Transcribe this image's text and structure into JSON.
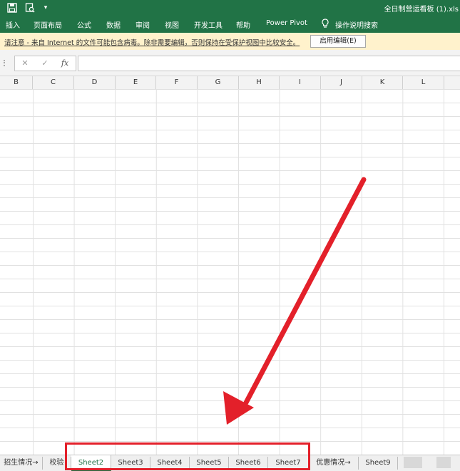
{
  "titlebar": {
    "title": "全日制营运看板 (1).xls",
    "qa_save_icon": "save-icon",
    "qa_preview_icon": "print-preview-icon",
    "qa_more_icon": "customize-arrow-icon"
  },
  "ribbon": {
    "tabs": [
      "插入",
      "页面布局",
      "公式",
      "数据",
      "审阅",
      "视图",
      "开发工具",
      "帮助",
      "Power Pivot"
    ],
    "tell_me": "操作说明搜索"
  },
  "message_bar": {
    "text": "请注意 - 来自 Internet 的文件可能包含病毒。除非需要编辑，否则保持在受保护视图中比较安全。",
    "enable_button": "启用编辑(E)"
  },
  "formula_bar": {
    "cancel": "✕",
    "enter": "✓",
    "fx": "fx",
    "value": ""
  },
  "columns": [
    "B",
    "C",
    "D",
    "E",
    "F",
    "G",
    "H",
    "I",
    "J",
    "K",
    "L"
  ],
  "sheet_tabs": {
    "tabs": [
      "招生情况→",
      "校验",
      "Sheet2",
      "Sheet3",
      "Sheet4",
      "Sheet5",
      "Sheet6",
      "Sheet7",
      "优惠情况→",
      "Sheet9"
    ],
    "active": "Sheet2"
  },
  "colors": {
    "brand_green": "#217346",
    "annotation_red": "#e3202a",
    "message_yellow": "#fff2cc"
  }
}
